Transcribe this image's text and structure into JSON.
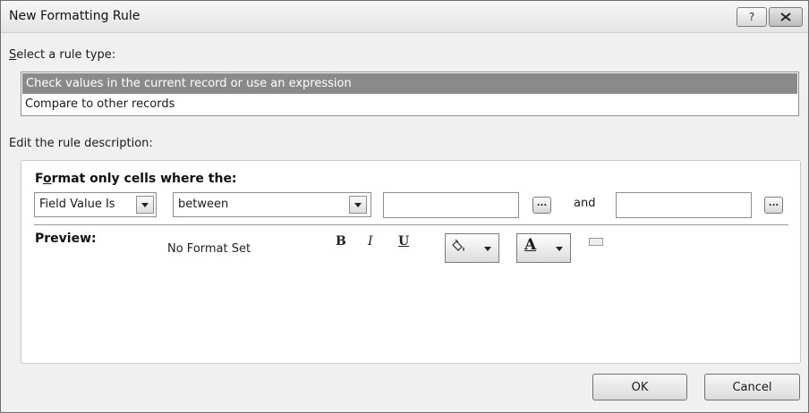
{
  "window": {
    "title": "New Formatting Rule",
    "help_label": "?"
  },
  "rule_type": {
    "label_accesskey": "S",
    "label_rest": "elect a rule type:",
    "items": [
      {
        "label": "Check values in the current record or use an expression",
        "selected": true
      },
      {
        "label": "Compare to other records",
        "selected": false
      }
    ]
  },
  "description": {
    "label": "Edit the rule description:",
    "format_label_pre": "F",
    "format_label_accesskey": "o",
    "format_label_rest": "rmat only cells where the:",
    "field_combo": {
      "value": "Field Value Is"
    },
    "operator_combo": {
      "value": "between"
    },
    "value1": "",
    "value2": "",
    "and_label": "and",
    "browse_label": "...",
    "preview_label": "Preview:",
    "preview_text": "No Format Set",
    "bold_label": "B",
    "italic_label": "I",
    "underline_label": "U",
    "font_color_label": "A"
  },
  "buttons": {
    "ok": "OK",
    "cancel": "Cancel"
  },
  "colors": {
    "selected_row": "#8a8a8a",
    "dialog_bg": "#f0f0f0",
    "panel_bg": "#ffffff"
  },
  "icons": [
    "help-icon",
    "close-icon",
    "chevron-down-icon",
    "ellipsis-icon",
    "fill-color-icon",
    "font-color-icon",
    "edit-icon"
  ]
}
